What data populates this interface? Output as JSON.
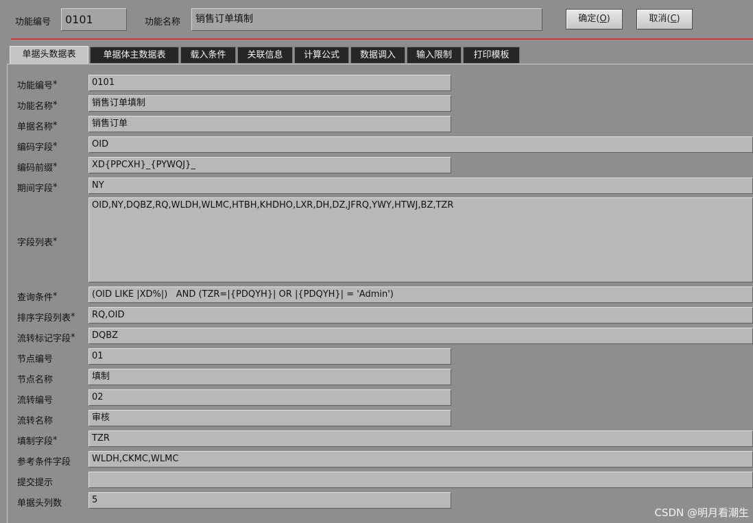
{
  "header": {
    "func_code_label": "功能编号",
    "func_code_value": "0101",
    "func_name_label": "功能名称",
    "func_name_value": "销售订单填制",
    "ok_text": "确定(",
    "ok_key": "O",
    "ok_close": ")",
    "cancel_text": "取消(",
    "cancel_key": "C",
    "cancel_close": ")"
  },
  "tabs": [
    "单据头数据表",
    "单据体主数据表",
    "载入条件",
    "关联信息",
    "计算公式",
    "数据调入",
    "输入限制",
    "打印模板"
  ],
  "form": {
    "func_code": {
      "label": "功能编号",
      "value": "0101"
    },
    "func_name": {
      "label": "功能名称",
      "value": "销售订单填制"
    },
    "doc_name": {
      "label": "单据名称",
      "value": "销售订单"
    },
    "code_field": {
      "label": "编码字段",
      "value": "OID"
    },
    "code_prefix": {
      "label": "编码前缀",
      "value": "XD{PPCXH}_{PYWQJ}_"
    },
    "period_field": {
      "label": "期间字段",
      "value": "NY"
    },
    "field_list": {
      "label": "字段列表",
      "value": "OID,NY,DQBZ,RQ,WLDH,WLMC,HTBH,KHDHO,LXR,DH,DZ,JFRQ,YWY,HTWJ,BZ,TZR"
    },
    "query_cond": {
      "label": "查询条件",
      "value": "(OID LIKE |XD%|)   AND (TZR=|{PDQYH}| OR |{PDQYH}| = 'Admin')"
    },
    "sort_fields": {
      "label": "排序字段列表",
      "value": "RQ,OID"
    },
    "flow_flag": {
      "label": "流转标记字段",
      "value": "DQBZ"
    },
    "node_code": {
      "label": "节点编号",
      "value": "01"
    },
    "node_name": {
      "label": "节点名称",
      "value": "填制"
    },
    "flow_code": {
      "label": "流转编号",
      "value": "02"
    },
    "flow_name": {
      "label": "流转名称",
      "value": "审核"
    },
    "fill_field": {
      "label": "填制字段",
      "value": "TZR"
    },
    "ref_cond": {
      "label": "参考条件字段",
      "value": "WLDH,CKMC,WLMC"
    },
    "submit_hint": {
      "label": "提交提示",
      "value": ""
    },
    "head_cols": {
      "label": "单据头列数",
      "value": "5"
    }
  },
  "required_mark": "*",
  "watermark": "CSDN @明月看潮生",
  "colors": {
    "accent_line": "#d9302c",
    "background": "#8e8e8e",
    "tab_dark": "#262626"
  }
}
